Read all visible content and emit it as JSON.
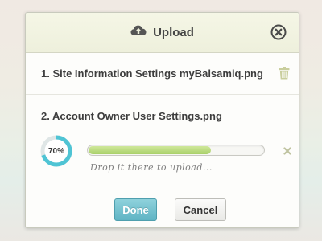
{
  "dialog": {
    "title": "Upload",
    "title_icon": "cloud-upload-icon",
    "close_icon": "close-icon"
  },
  "files": [
    {
      "label": "1. Site Information Settings myBalsamiq.png",
      "action_icon": "trash-icon"
    },
    {
      "label": "2. Account Owner User Settings.png",
      "progress": 70,
      "progress_label": "70%",
      "hint": "Drop it there to upload...",
      "action_icon": "cancel-x-icon"
    }
  ],
  "buttons": {
    "done": "Done",
    "cancel": "Cancel"
  },
  "colors": {
    "accent": "#5fb4c4",
    "progress": "#a9d06a",
    "ring": "#4fc4d4"
  }
}
